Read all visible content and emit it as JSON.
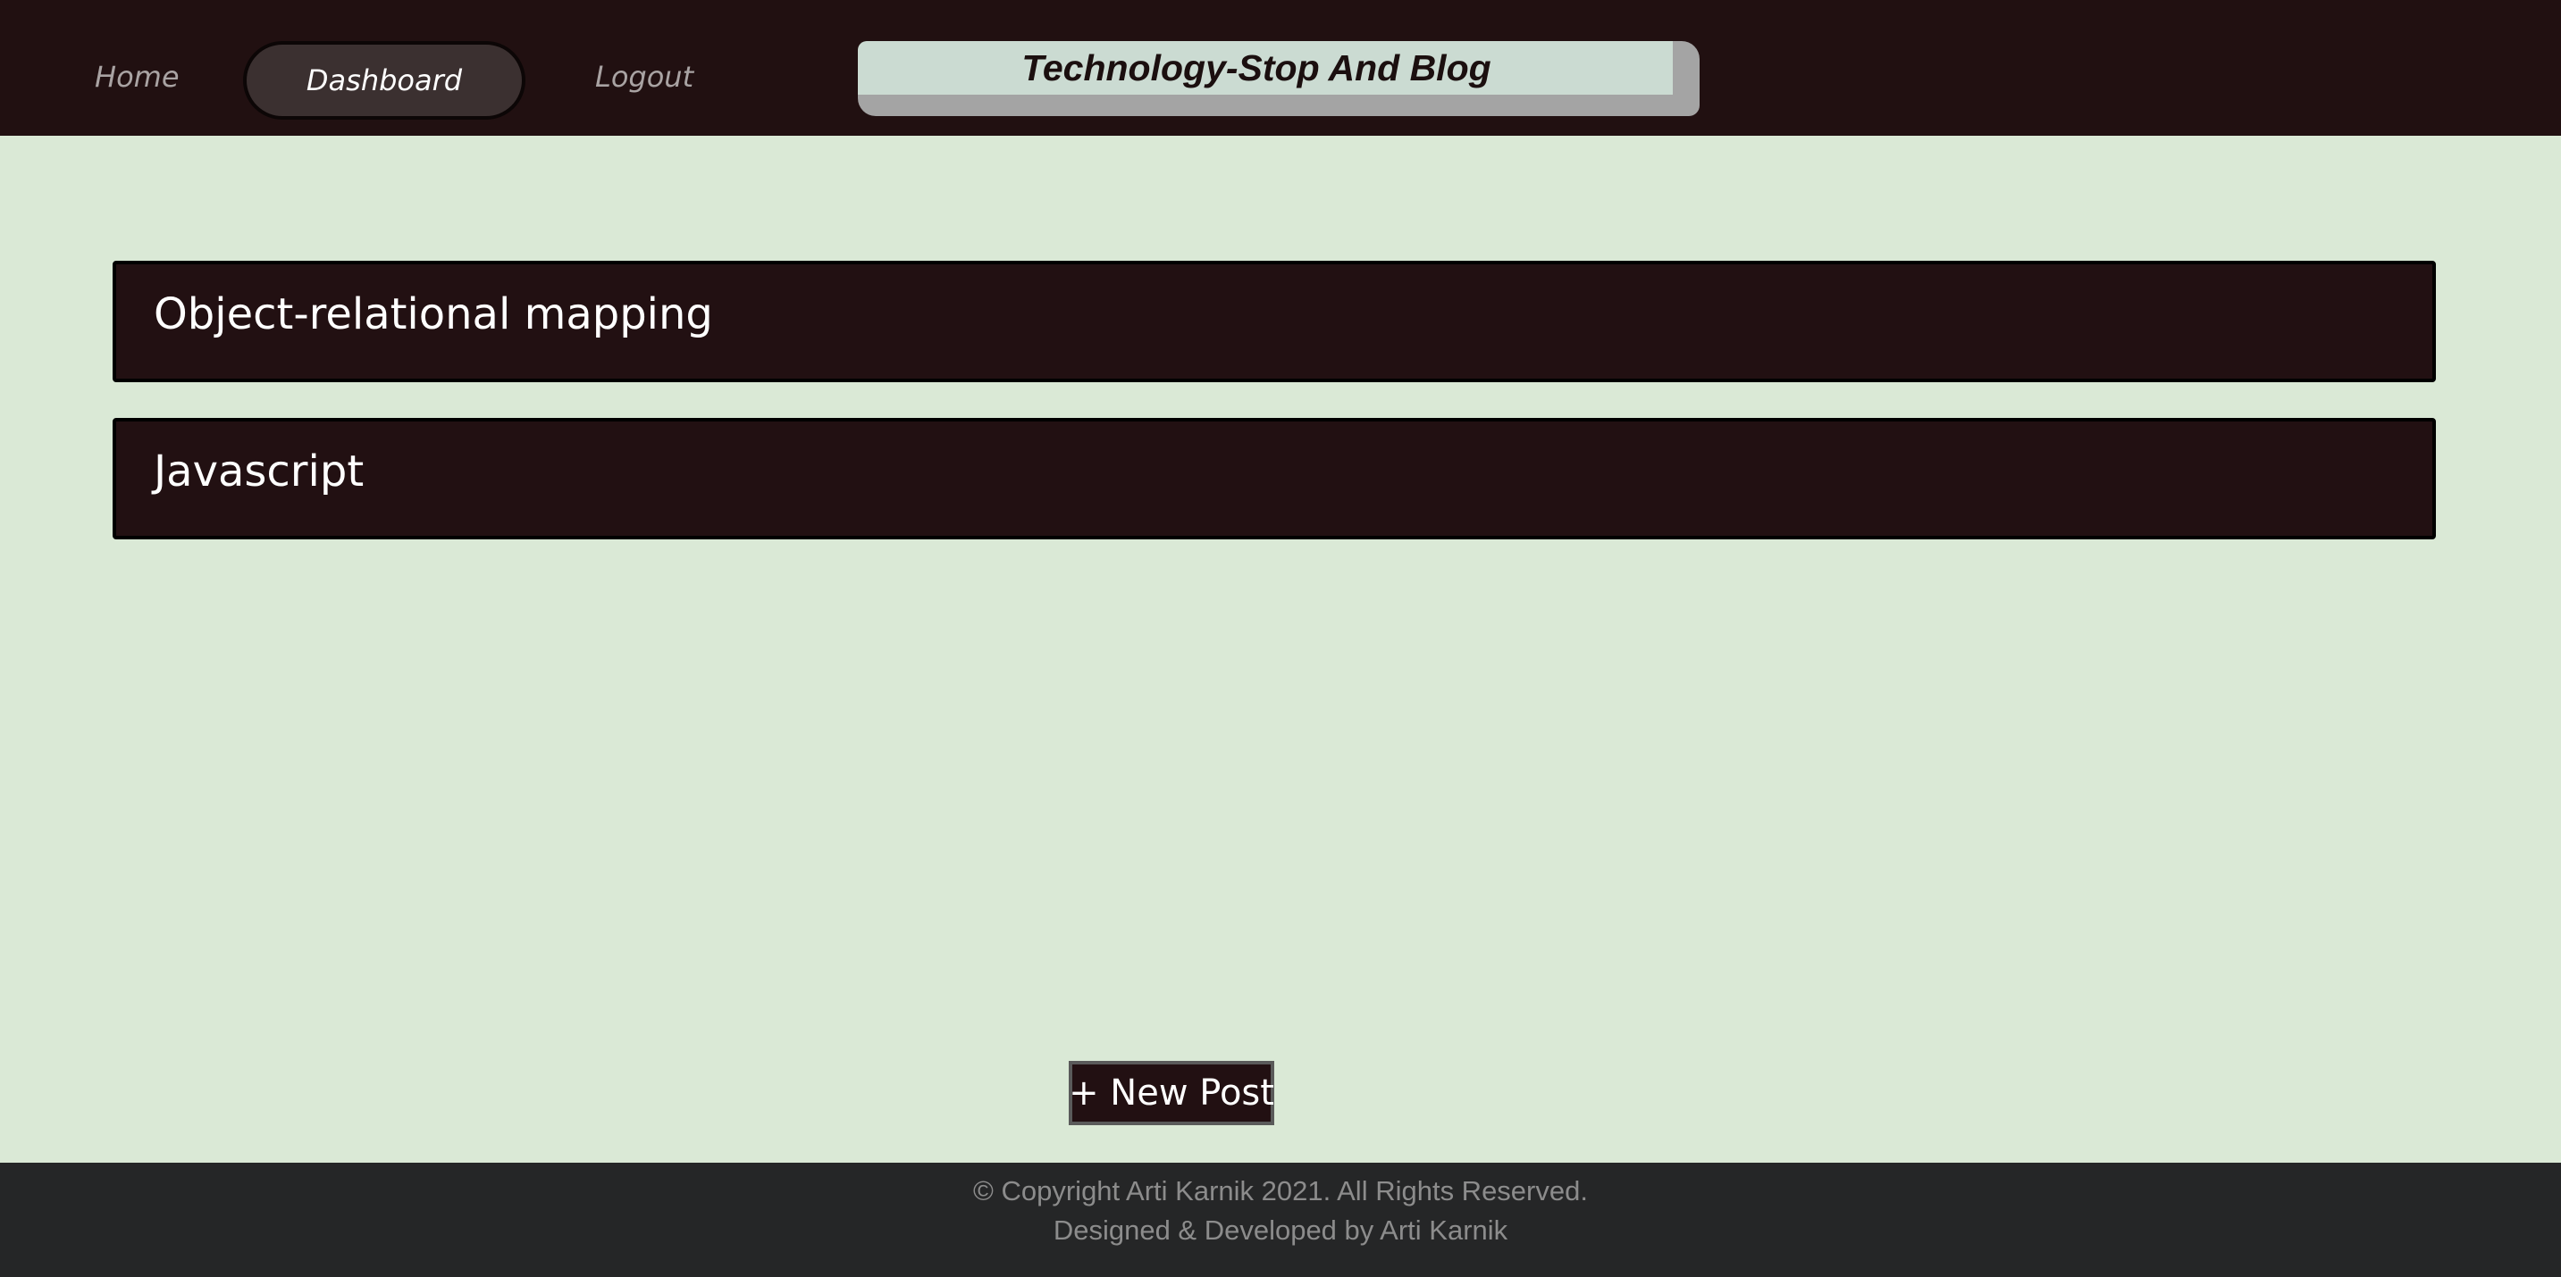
{
  "header": {
    "nav": {
      "home_label": "Home",
      "dashboard_label": "Dashboard",
      "logout_label": "Logout"
    },
    "site_title": "Technology-Stop And Blog"
  },
  "posts": [
    {
      "title": "Object-relational mapping"
    },
    {
      "title": "Javascript"
    }
  ],
  "actions": {
    "new_post_label": "+ New Post"
  },
  "footer": {
    "copyright": "© Copyright Arti Karnik 2021. All Rights Reserved.",
    "credits": "Designed & Developed by Arti Karnik"
  },
  "colors": {
    "page_background": "#dae9d6",
    "header_background": "#211011",
    "card_background": "#221012",
    "footer_background": "#252627",
    "title_box": "#cbdbd2"
  }
}
